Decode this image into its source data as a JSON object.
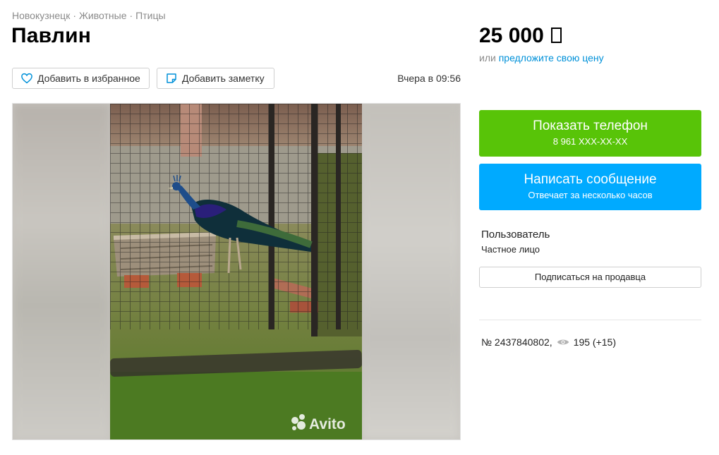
{
  "breadcrumbs": [
    "Новокузнецк",
    "Животные",
    "Птицы"
  ],
  "breadcrumb_separator": "·",
  "title": "Павлин",
  "actions": {
    "favorite_label": "Добавить в избранное",
    "note_label": "Добавить заметку"
  },
  "date": "Вчера в 09:56",
  "price": {
    "amount": "25 000",
    "offer_prefix": "или",
    "offer_link": "предложите свою цену"
  },
  "phone": {
    "label": "Показать телефон",
    "number": "8 961 XXX-XX-XX"
  },
  "message": {
    "label": "Написать сообщение",
    "subtext": "Отвечает за несколько часов"
  },
  "seller": {
    "name": "Пользователь",
    "type": "Частное лицо",
    "subscribe_label": "Подписаться на продавца"
  },
  "listing": {
    "number": "№ 2437840802,",
    "views": "195 (+15)"
  },
  "gallery": {
    "watermark": "Avito"
  },
  "colors": {
    "phone_button": "#58c408",
    "message_button": "#00aaff",
    "link": "#0091d9"
  }
}
